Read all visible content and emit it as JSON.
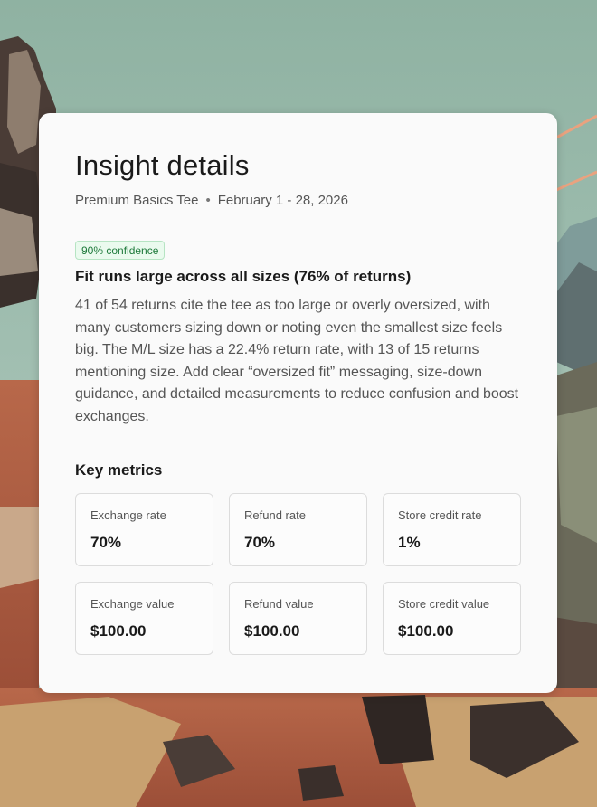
{
  "insight": {
    "title": "Insight details",
    "product": "Premium Basics Tee",
    "separator": "•",
    "date_range": "February 1 - 28, 2026",
    "confidence_badge": "90% confidence",
    "headline": "Fit runs large across all sizes (76% of returns)",
    "description": "41 of 54 returns cite the tee as too large or overly oversized, with many customers sizing down or noting even the smallest size feels big. The M/L size has a 22.4% return rate, with 13 of 15 returns mentioning size. Add clear “oversized fit” messaging, size-down guidance, and detailed measurements to reduce confusion and boost exchanges."
  },
  "key_metrics": {
    "title": "Key metrics",
    "items": [
      {
        "label": "Exchange rate",
        "value": "70%"
      },
      {
        "label": "Refund rate",
        "value": "70%"
      },
      {
        "label": "Store credit rate",
        "value": "1%"
      },
      {
        "label": "Exchange value",
        "value": "$100.00"
      },
      {
        "label": "Refund value",
        "value": "$100.00"
      },
      {
        "label": "Store credit value",
        "value": "$100.00"
      }
    ]
  },
  "colors": {
    "sky": "#93b5a6",
    "card_background": "#fafafa",
    "badge_text": "#1e7a3b",
    "badge_background": "#eafaee",
    "badge_border": "#b6e4c3"
  }
}
